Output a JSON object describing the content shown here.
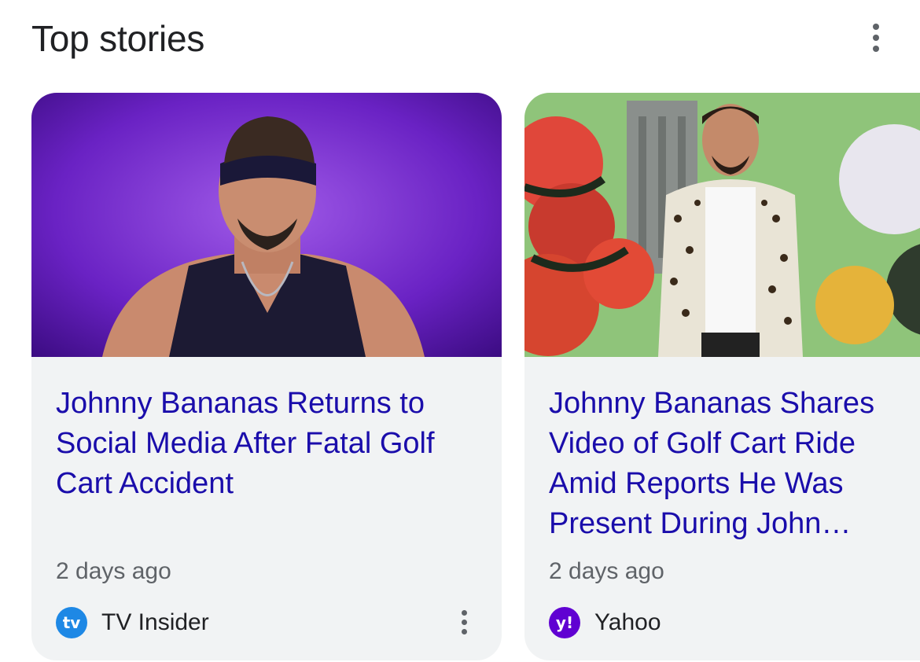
{
  "header": {
    "title": "Top stories"
  },
  "stories": [
    {
      "headline": "Johnny Bananas Returns to Social Media After Fatal Golf Cart Accident",
      "time": "2 days ago",
      "source": "TV Insider",
      "source_logo_text": "tv",
      "source_logo_color": "#1e88e5"
    },
    {
      "headline": "Johnny Bananas Shares Video of Golf Cart Ride Amid Reports He Was Present During John…",
      "time": "2 days ago",
      "source": "Yahoo",
      "source_logo_text": "y!",
      "source_logo_color": "#6001d2"
    }
  ],
  "colors": {
    "headline": "#1a0dab",
    "card_bg": "#f1f3f4",
    "muted": "#5f6368"
  }
}
